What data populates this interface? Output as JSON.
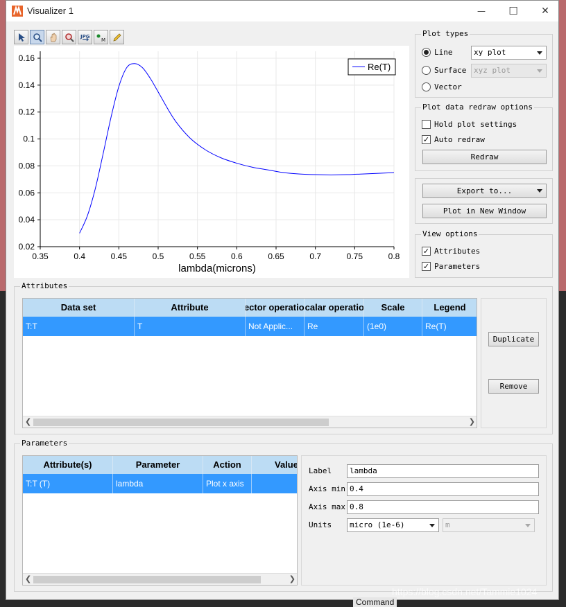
{
  "window": {
    "title": "Visualizer 1",
    "minimize_glyph": "—",
    "maximize_glyph": "☐",
    "close_glyph": "✕"
  },
  "toolbar": {
    "icons": [
      "select-arrow-icon",
      "zoom-icon",
      "pan-hand-icon",
      "zoom-tool-icon",
      "export-jpg-icon",
      "data-marker-icon",
      "pencil-icon"
    ],
    "jpg_text": "JPG",
    "marker_text": "M"
  },
  "plot": {
    "xlabel": "lambda(microns)",
    "legend": "Re(T)",
    "line_color": "#0000ff",
    "xticks": [
      "0.35",
      "0.4",
      "0.45",
      "0.5",
      "0.55",
      "0.6",
      "0.65",
      "0.7",
      "0.75",
      "0.8"
    ],
    "yticks": [
      "0.02",
      "0.04",
      "0.06",
      "0.08",
      "0.1",
      "0.12",
      "0.14",
      "0.16"
    ]
  },
  "chart_data": {
    "type": "line",
    "title": "",
    "xlabel": "lambda(microns)",
    "ylabel": "",
    "xlim": [
      0.35,
      0.8
    ],
    "ylim": [
      0.02,
      0.16
    ],
    "grid": true,
    "legend_position": "top-right",
    "series": [
      {
        "name": "Re(T)",
        "x": [
          0.4,
          0.41,
          0.42,
          0.43,
          0.44,
          0.45,
          0.46,
          0.47,
          0.48,
          0.49,
          0.5,
          0.52,
          0.54,
          0.56,
          0.58,
          0.6,
          0.62,
          0.64,
          0.66,
          0.68,
          0.7,
          0.72,
          0.74,
          0.76,
          0.78,
          0.8
        ],
        "y": [
          0.03,
          0.043,
          0.063,
          0.089,
          0.116,
          0.139,
          0.153,
          0.156,
          0.153,
          0.145,
          0.135,
          0.115,
          0.101,
          0.092,
          0.086,
          0.082,
          0.079,
          0.077,
          0.075,
          0.074,
          0.0735,
          0.0733,
          0.0735,
          0.074,
          0.0745,
          0.075
        ]
      }
    ]
  },
  "plot_types": {
    "title": "Plot types",
    "options": [
      {
        "label": "Line",
        "selected": true
      },
      {
        "label": "Surface",
        "selected": false
      },
      {
        "label": "Vector",
        "selected": false
      }
    ],
    "line_combo": "xy plot",
    "surface_combo": "xyz plot"
  },
  "redraw_options": {
    "title": "Plot data redraw options",
    "hold_label": "Hold plot settings",
    "hold_checked": false,
    "auto_label": "Auto redraw",
    "auto_checked": true,
    "redraw_button": "Redraw"
  },
  "export": {
    "export_button": "Export to...",
    "new_window_button": "Plot in New Window"
  },
  "view_options": {
    "title": "View options",
    "attributes_label": "Attributes",
    "attributes_checked": true,
    "parameters_label": "Parameters",
    "parameters_checked": true
  },
  "attributes": {
    "title": "Attributes",
    "headers": [
      "Data set",
      "Attribute",
      "Vector operation",
      "Scalar operation",
      "Scale",
      "Legend"
    ],
    "rows": [
      [
        "T:T",
        "T",
        "Not Applic...",
        "Re",
        "(1e0)",
        "Re(T)"
      ]
    ],
    "duplicate_button": "Duplicate",
    "remove_button": "Remove"
  },
  "parameters": {
    "title": "Parameters",
    "headers": [
      "Attribute(s)",
      "Parameter",
      "Action",
      "Value"
    ],
    "rows": [
      [
        "T:T (T)",
        "lambda",
        "Plot x axis",
        ""
      ]
    ],
    "label_label": "Label",
    "label_value": "lambda",
    "axis_min_label": "Axis min",
    "axis_min_value": "0.4",
    "axis_max_label": "Axis max",
    "axis_max_value": "0.8",
    "units_label": "Units",
    "units_value": "micro (1e-6)",
    "unit_symbol": "m"
  },
  "background": {
    "watermark": "https://blog.csdn.net/Tammie1024",
    "command_tab": "Command"
  }
}
